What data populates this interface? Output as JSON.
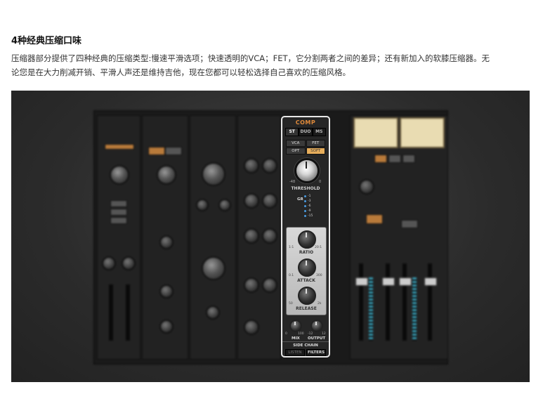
{
  "article": {
    "title": "4种经典压缩口味",
    "description": "压缩器部分提供了四种经典的压缩类型:慢速平滑选项；快速透明的VCA；FET，它分割两者之间的差异；还有新加入的软膝压缩器。无论您是在大力削减开销、平滑人声还是维持吉他，现在您都可以轻松选择自己喜欢的压缩风格。"
  },
  "comp_panel": {
    "title": "COMP",
    "tabs": [
      "ST",
      "DUO",
      "MS"
    ],
    "active_tab": "ST",
    "types": [
      "VCA",
      "FET",
      "OPT",
      "SOFT"
    ],
    "selected_type": "SOFT",
    "threshold": {
      "label": "THRESHOLD",
      "min": "-48",
      "max": "0"
    },
    "gr": {
      "label": "GR",
      "scale": [
        "-1",
        "-3",
        "-6",
        "-9",
        "-15"
      ]
    },
    "ratio": {
      "label": "RATIO",
      "min": "1:1",
      "max": "20:1"
    },
    "attack": {
      "label": "ATTACK",
      "min": "0.1",
      "max": "300"
    },
    "release": {
      "label": "RELEASE",
      "min": "50",
      "max": "2k"
    },
    "mix": {
      "label": "MIX",
      "min": "0",
      "max": "100"
    },
    "output": {
      "label": "OUTPUT",
      "min": "-12",
      "max": "12"
    },
    "side_chain": {
      "label": "SIDE CHAIN",
      "buttons": [
        "LISTEN",
        "FILTERS"
      ],
      "active": "FILTERS"
    }
  },
  "colors": {
    "accent": "#e08a3a",
    "selected_type": "#e7ae5c",
    "led": "#4a9be0"
  }
}
